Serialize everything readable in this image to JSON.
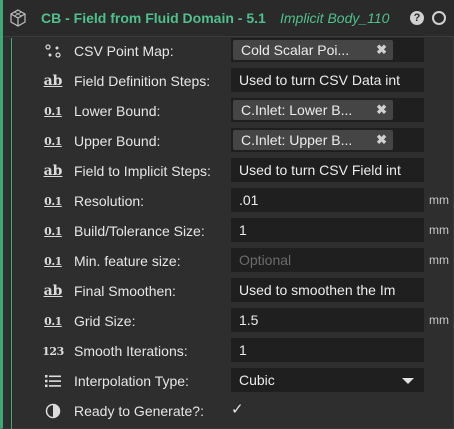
{
  "header": {
    "title": "CB - Field from Fluid Domain - 5.1",
    "subtitle": "Implicit Body_110",
    "help_label": "?"
  },
  "rows": [
    {
      "name": "csv-point-map",
      "icon": "point-map-icon",
      "label": "CSV Point Map:",
      "kind": "chip",
      "value": "Cold Scalar Poi..."
    },
    {
      "name": "field-definition-steps",
      "icon": "text-ab-icon",
      "label": "Field Definition Steps:",
      "kind": "text",
      "value": "Used to turn CSV Data int"
    },
    {
      "name": "lower-bound",
      "icon": "scalar-icon",
      "label": "Lower Bound:",
      "kind": "chip",
      "value": "C.Inlet: Lower B..."
    },
    {
      "name": "upper-bound",
      "icon": "scalar-icon",
      "label": "Upper Bound:",
      "kind": "chip",
      "value": "C.Inlet: Upper B..."
    },
    {
      "name": "field-to-implicit-steps",
      "icon": "text-ab-icon",
      "label": "Field to Implicit Steps:",
      "kind": "text",
      "value": "Used to turn CSV Field int"
    },
    {
      "name": "resolution",
      "icon": "scalar-icon",
      "label": "Resolution:",
      "kind": "text",
      "value": ".01",
      "unit": "mm"
    },
    {
      "name": "build-tolerance-size",
      "icon": "scalar-icon",
      "label": "Build/Tolerance Size:",
      "kind": "text",
      "value": "1",
      "unit": "mm"
    },
    {
      "name": "min-feature-size",
      "icon": "scalar-icon",
      "label": "Min. feature size:",
      "kind": "placeholder",
      "value": "Optional",
      "unit": "mm",
      "muted": true
    },
    {
      "name": "final-smoothen",
      "icon": "text-ab-icon",
      "label": "Final Smoothen:",
      "kind": "text",
      "value": "Used to smoothen the Im"
    },
    {
      "name": "grid-size",
      "icon": "scalar-icon",
      "label": "Grid Size:",
      "kind": "text",
      "value": "1.5",
      "unit": "mm"
    },
    {
      "name": "smooth-iterations",
      "icon": "integer-icon",
      "label": "Smooth Iterations:",
      "kind": "text",
      "value": "1"
    },
    {
      "name": "interpolation-type",
      "icon": "list-icon",
      "label": "Interpolation Type:",
      "kind": "dropdown",
      "value": "Cubic"
    },
    {
      "name": "ready-to-generate",
      "icon": "half-circle-icon",
      "label": "Ready to Generate?:",
      "kind": "checkbox",
      "value": "✓"
    }
  ],
  "icons": {
    "scalar_glyph": "0.1",
    "text_glyph": "ab",
    "integer_glyph": "123"
  },
  "colors": {
    "accent": "#4fc08d",
    "background": "#2e2e2e",
    "field_bg": "#1f1f1f",
    "chip_bg": "#454545"
  }
}
